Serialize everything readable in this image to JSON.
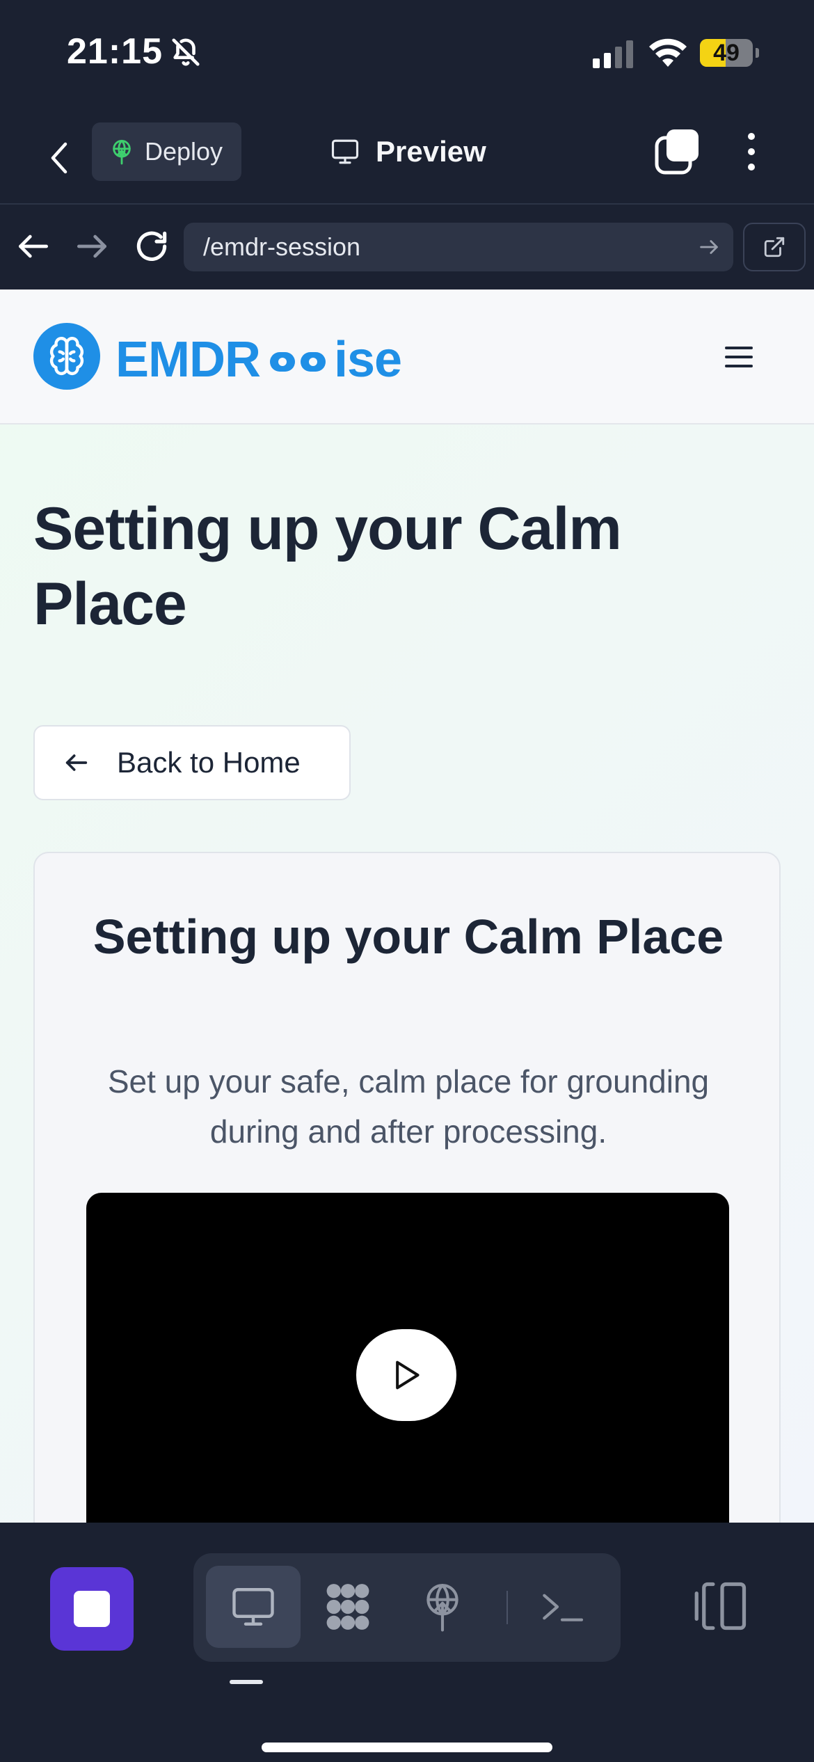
{
  "status_bar": {
    "time": "21:15",
    "battery_level": "49",
    "battery_percent": 49
  },
  "toolbar": {
    "deploy_label": "Deploy",
    "preview_label": "Preview"
  },
  "browser": {
    "url": "/emdr-session"
  },
  "site": {
    "logo_prefix": "EMDR",
    "logo_suffix": "ise"
  },
  "page": {
    "title": "Setting up your Calm Place",
    "back_label": "Back to Home"
  },
  "card": {
    "title": "Setting up your Calm Place",
    "description": "Set up your safe, calm place for grounding during and after processing."
  },
  "colors": {
    "brand_blue": "#1f8fe6",
    "stop_purple": "#5a35d6",
    "app_dark": "#1b2131",
    "battery_yellow": "#f4d314"
  },
  "icons": {
    "bottom_tools": [
      "monitor-icon",
      "grid-icon",
      "deploy-icon",
      "terminal-icon"
    ],
    "logo": "brain-icon"
  }
}
